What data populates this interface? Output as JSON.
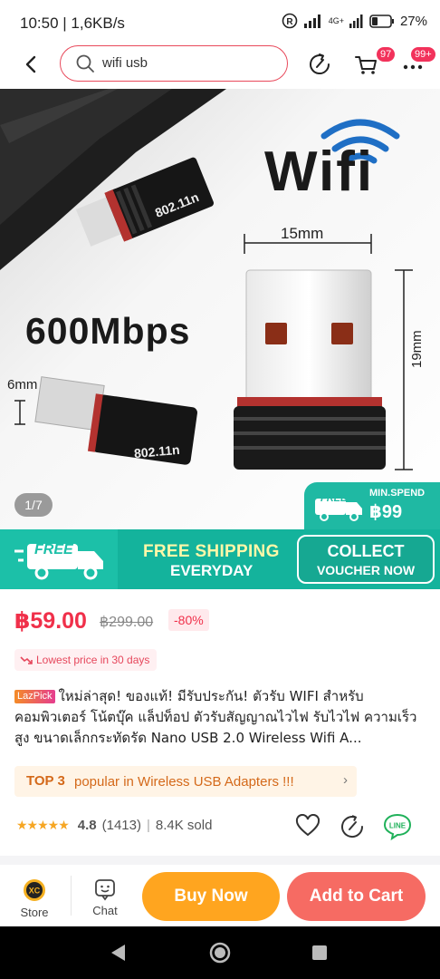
{
  "status_bar": {
    "time": "10:50 | 1,6KB/s",
    "network": "4G+",
    "battery": "27%"
  },
  "search": {
    "query": "wifi usb"
  },
  "header": {
    "cart_badge": "97",
    "more_badge": "99+"
  },
  "gallery": {
    "counter": "1/7",
    "speed_label": "600Mbps",
    "brand_label": "Wifi",
    "model_label": "802.11n",
    "dim_width": "15mm",
    "dim_height": "19mm",
    "dim_depth": "6mm",
    "min_spend_label": "MIN.SPEND",
    "min_spend_value": "฿99",
    "min_spend_free": "FREE"
  },
  "banner": {
    "free": "FREE",
    "title": "FREE SHIPPING",
    "subtitle": "EVERYDAY",
    "collect": "COLLECT",
    "voucher": "VOUCHER NOW"
  },
  "product": {
    "price": "฿59.00",
    "original_price": "฿299.00",
    "discount": "-80%",
    "lowest_price_tag": "Lowest price in 30 days",
    "badge": "LazPick",
    "title": "ใหม่ล่าสุด! ของแท้! มีรับประกัน! ตัวรับ WIFI สำหรับ คอมพิวเตอร์ โน้ตบุ๊ค แล็ปท็อป ตัวรับสัญญาณไวไฟ รับไวไฟ ความเร็วสูง ขนาดเล็กกระทัดรัด Nano USB 2.0 Wireless Wifi A...",
    "rank_label": "TOP 3",
    "rank_text": "popular in Wireless USB Adapters !!!",
    "rating": "4.8",
    "rating_count": "(1413)",
    "sold": "8.4K sold",
    "stars": "★★★★★"
  },
  "bottom_bar": {
    "store": "Store",
    "chat": "Chat",
    "buy_now": "Buy Now",
    "add_to_cart": "Add to Cart",
    "store_logo": "XC"
  },
  "colors": {
    "accent": "#f0304a",
    "teal": "#14b39c",
    "buy": "#ffa51f",
    "cart": "#f66b63"
  }
}
